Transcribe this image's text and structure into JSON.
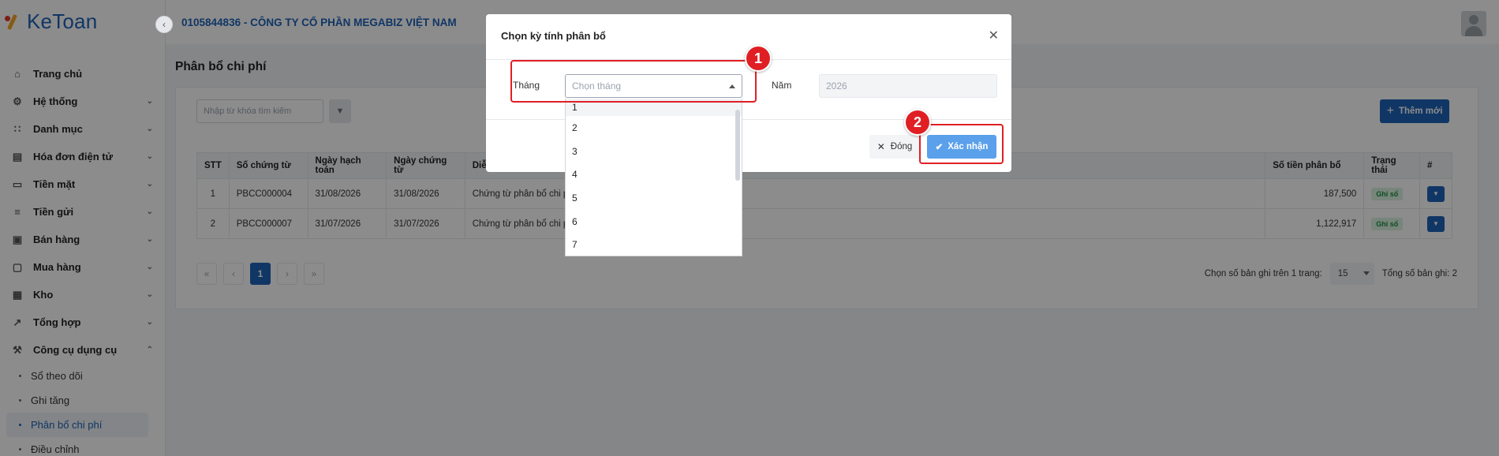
{
  "app": {
    "logo_text": "KeToan",
    "company": "0105844836 - CÔNG TY CỔ PHẦN MEGABIZ VIỆT NAM"
  },
  "sidebar": {
    "items": [
      {
        "label": "Trang chủ",
        "icon": "home-icon"
      },
      {
        "label": "Hệ thống",
        "icon": "gear-icon"
      },
      {
        "label": "Danh mục",
        "icon": "grid-icon"
      },
      {
        "label": "Hóa đơn điện tử",
        "icon": "invoice-icon"
      },
      {
        "label": "Tiền mặt",
        "icon": "cash-icon"
      },
      {
        "label": "Tiền gửi",
        "icon": "bank-icon"
      },
      {
        "label": "Bán hàng",
        "icon": "sales-icon"
      },
      {
        "label": "Mua hàng",
        "icon": "purchase-icon"
      },
      {
        "label": "Kho",
        "icon": "warehouse-icon"
      },
      {
        "label": "Tổng hợp",
        "icon": "chart-icon"
      },
      {
        "label": "Công cụ dụng cụ",
        "icon": "tools-icon"
      }
    ],
    "subitems": [
      "Sổ theo dõi",
      "Ghi tăng",
      "Phân bổ chi phí",
      "Điều chỉnh"
    ],
    "active_subitem": "Phân bổ chi phí"
  },
  "page": {
    "title": "Phân bổ chi phí",
    "search_placeholder": "Nhập từ khóa tìm kiếm",
    "add_label": "Thêm mới"
  },
  "table": {
    "headers": {
      "stt": "STT",
      "so_chung_tu": "Số chứng từ",
      "ngay_hach_toan": "Ngày hạch toán",
      "ngay_chung_tu": "Ngày chứng từ",
      "dien_giai": "Diễ",
      "so_tien": "Số tiền phân bổ",
      "trang_thai": "Trạng thái",
      "hash": "#"
    },
    "rows": [
      {
        "stt": "1",
        "so_chung_tu": "PBCC000004",
        "ngay_hach_toan": "31/08/2026",
        "ngay_chung_tu": "31/08/2026",
        "dien_giai": "Chứng từ phân bổ chi p",
        "so_tien": "187,500",
        "trang_thai": "Ghi sổ"
      },
      {
        "stt": "2",
        "so_chung_tu": "PBCC000007",
        "ngay_hach_toan": "31/07/2026",
        "ngay_chung_tu": "31/07/2026",
        "dien_giai": "Chứng từ phân bổ chi p",
        "so_tien": "1,122,917",
        "trang_thai": "Ghi sổ"
      }
    ]
  },
  "pagination": {
    "current_page": "1",
    "per_page_label": "Chọn số bản ghi trên 1 trang:",
    "per_page_value": "15",
    "total_label": "Tổng số bản ghi:",
    "total_value": "2"
  },
  "modal": {
    "title": "Chọn kỳ tính phân bổ",
    "month_label": "Tháng",
    "month_placeholder": "Chọn tháng",
    "year_label": "Năm",
    "year_value": "2026",
    "close_label": "Đóng",
    "confirm_label": "Xác nhận",
    "month_options": [
      "1",
      "2",
      "3",
      "4",
      "5",
      "6",
      "7"
    ]
  },
  "annotations": {
    "badge_1": "1",
    "badge_2": "2",
    "color": "#e01f25"
  },
  "colors": {
    "primary": "#1e63b8",
    "confirm": "#5aa0ea",
    "badge_green": "#1a8a3f"
  }
}
